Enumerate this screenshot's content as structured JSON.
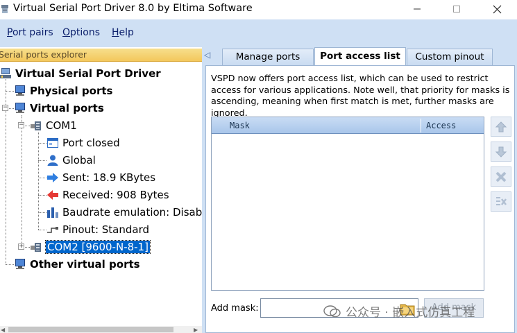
{
  "window": {
    "title": "Virtual Serial Port Driver 8.0 by Eltima Software"
  },
  "menu": {
    "items": [
      {
        "underline": "P",
        "rest": "ort pairs"
      },
      {
        "underline": "O",
        "rest": "ptions"
      },
      {
        "underline": "H",
        "rest": "elp"
      }
    ]
  },
  "explorer": {
    "header": "Serial ports explorer",
    "root": "Virtual Serial Port Driver",
    "physical": "Physical ports",
    "virtual": "Virtual ports",
    "com1": {
      "label": "COM1",
      "details": [
        "Port closed",
        "Global",
        "Sent: 18.9 KBytes",
        "Received: 908 Bytes",
        "Baudrate emulation: Disabl",
        "Pinout: Standard"
      ]
    },
    "com2": "COM2 [9600-N-8-1]",
    "other": "Other virtual ports"
  },
  "tabs": [
    {
      "label": "Manage ports",
      "active": false
    },
    {
      "label": "Port access list",
      "active": true
    },
    {
      "label": "Custom pinout",
      "active": false
    }
  ],
  "access_list": {
    "description": "VSPD now offers port access list, which can be used to restrict access for various applications. Note well, that priority for masks is ascending, meaning when first match is met, further masks are ignored.",
    "columns": {
      "mask": "Mask",
      "access": "Access"
    },
    "rows": [],
    "add_mask_label": "Add mask:",
    "add_mask_value": "",
    "add_button": "Add mask"
  },
  "watermark": "公众号 · 嵌入式仿真工程",
  "colors": {
    "menubar_bg": "#cfe0f4",
    "explorer_header": "#f3c75c",
    "selection": "#0066cc",
    "grid_header": "#a9c6ea"
  }
}
